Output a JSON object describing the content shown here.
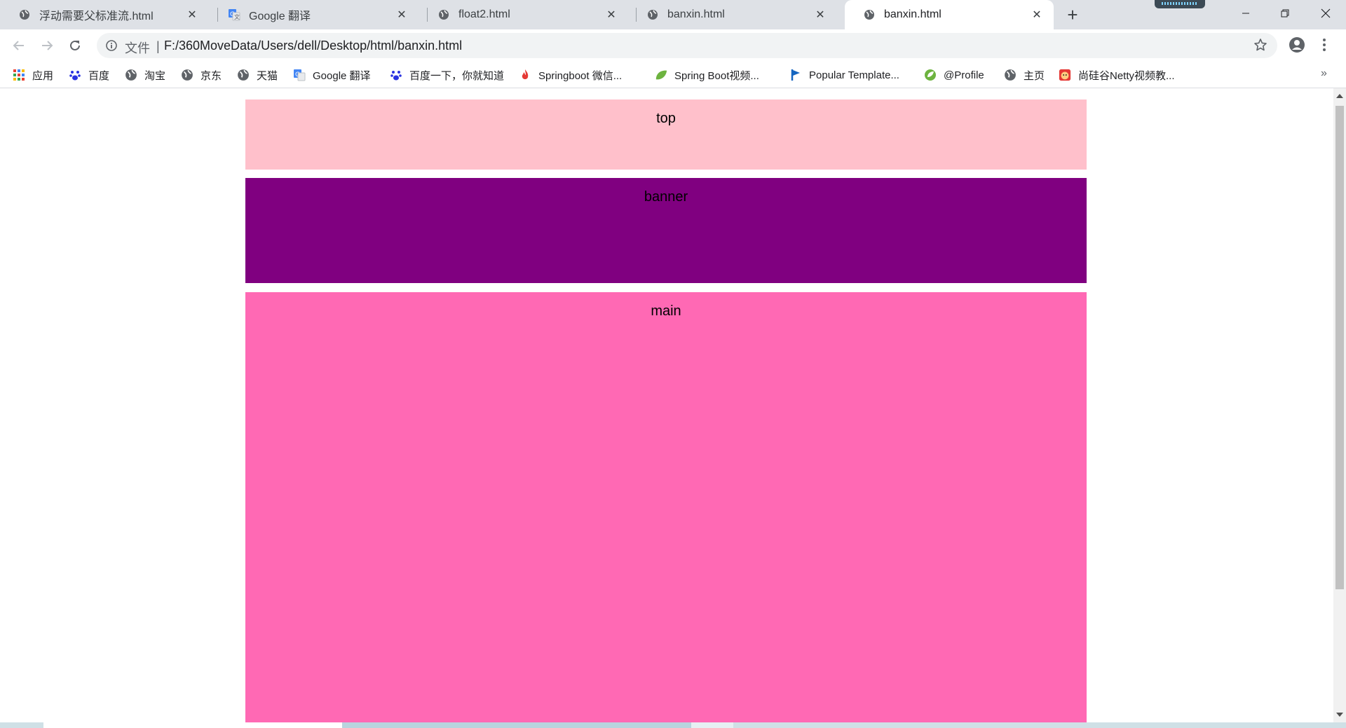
{
  "tabs": [
    {
      "title": "浮动需要父标准流.html",
      "icon": "globe-icon",
      "active": false
    },
    {
      "title": "Google 翻译",
      "icon": "google-translate-icon",
      "active": false
    },
    {
      "title": "float2.html",
      "icon": "globe-icon",
      "active": false
    },
    {
      "title": "banxin.html",
      "icon": "globe-icon",
      "active": false
    },
    {
      "title": "banxin.html",
      "icon": "globe-icon",
      "active": true
    }
  ],
  "tab_close_glyph": "✕",
  "new_tab_glyph": "+",
  "address_bar": {
    "scheme_label": "文件",
    "divider": "|",
    "url": "F:/360MoveData/Users/dell/Desktop/html/banxin.html"
  },
  "bookmarks": [
    {
      "label": "应用",
      "icon": "apps-grid-icon"
    },
    {
      "label": "百度",
      "icon": "baidu-paw-icon"
    },
    {
      "label": "淘宝",
      "icon": "globe-icon"
    },
    {
      "label": "京东",
      "icon": "globe-icon"
    },
    {
      "label": "天猫",
      "icon": "globe-icon"
    },
    {
      "label": "Google 翻译",
      "icon": "google-translate-icon"
    },
    {
      "label": "百度一下，你就知道",
      "icon": "baidu-paw-icon"
    },
    {
      "label": "Springboot 微信...",
      "icon": "flame-icon"
    },
    {
      "label": "Spring Boot视频...",
      "icon": "leaf-icon"
    },
    {
      "label": "Popular Template...",
      "icon": "flag-icon"
    },
    {
      "label": "@Profile",
      "icon": "spring-icon"
    },
    {
      "label": "主页",
      "icon": "globe-icon"
    },
    {
      "label": "尚硅谷Netty视频教...",
      "icon": "mascot-icon"
    }
  ],
  "bookmarks_overflow": "»",
  "page": {
    "top_label": "top",
    "banner_label": "banner",
    "main_label": "main"
  },
  "colors": {
    "top": "#ffc0cb",
    "banner": "#800080",
    "main": "#ff69b4"
  }
}
